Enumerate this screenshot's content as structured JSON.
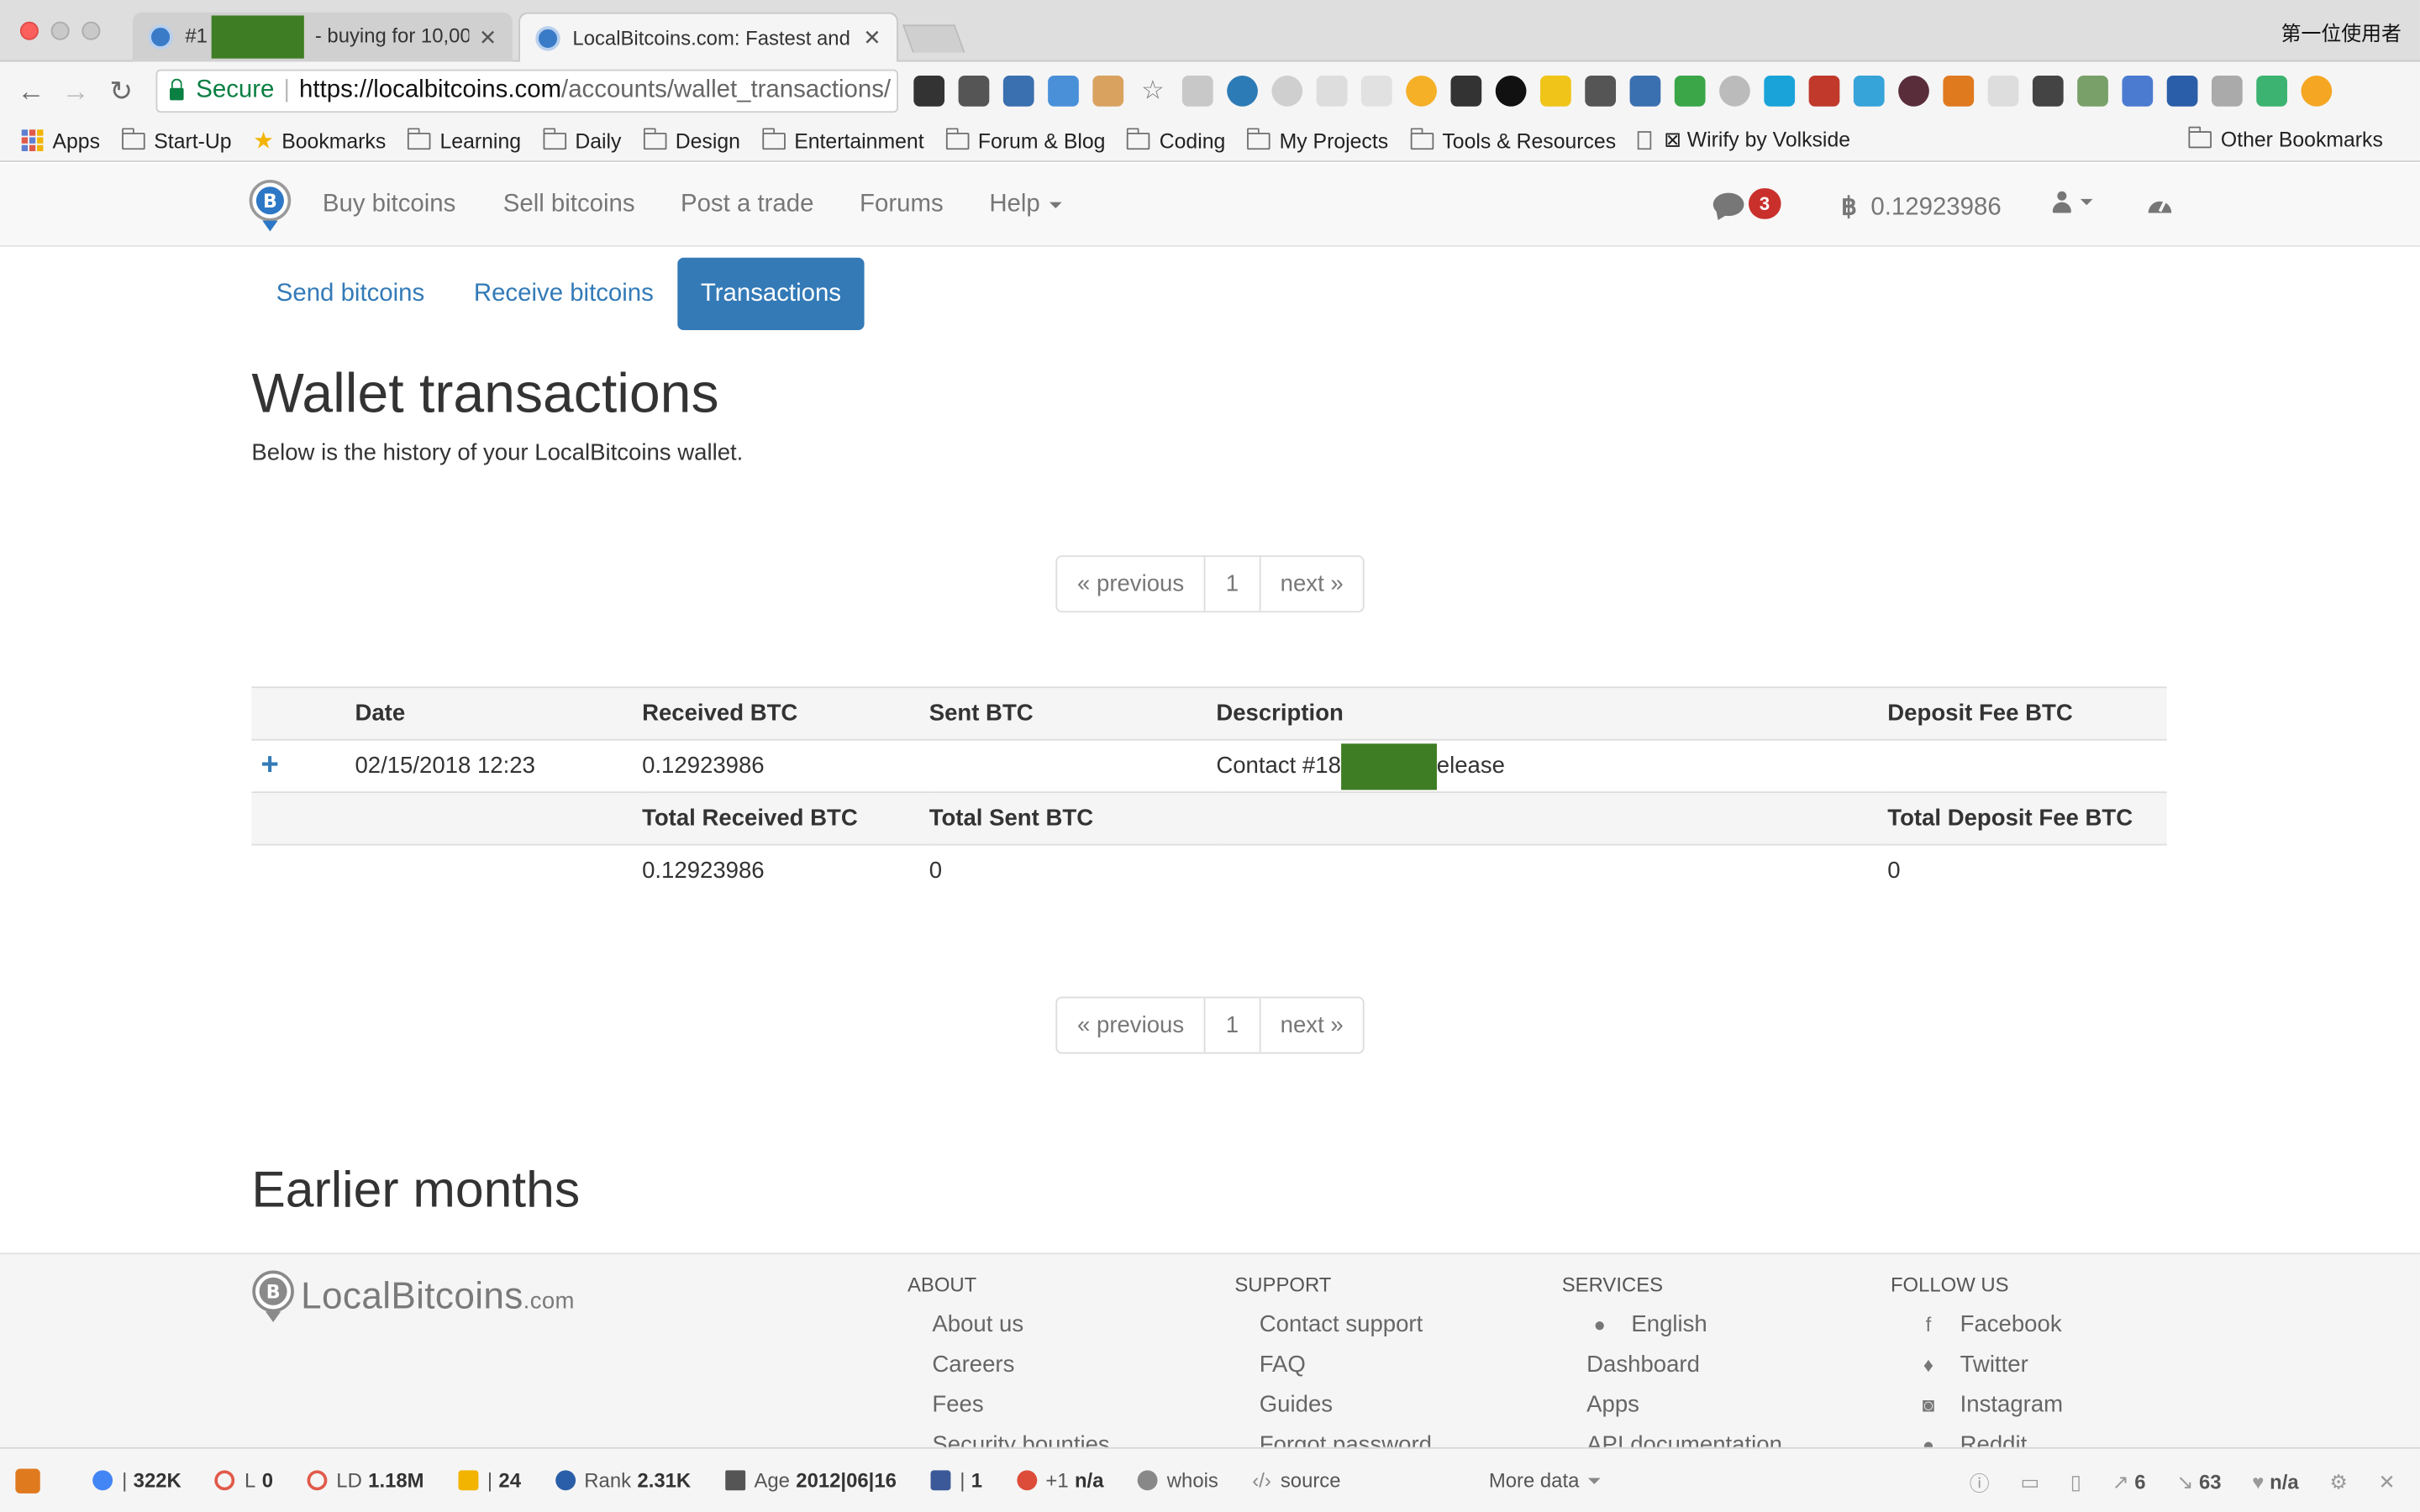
{
  "browser": {
    "tabs": [
      {
        "title_prefix": "#1",
        "title_suffix": " - buying for 10,00",
        "active": false
      },
      {
        "title": "LocalBitcoins.com: Fastest and",
        "active": true
      }
    ],
    "profile_name": "第一位使用者",
    "secure_label": "Secure",
    "url_host": "https://localbitcoins.com",
    "url_path": "/accounts/wallet_transactions/",
    "bookmarks": [
      "Apps",
      "Start-Up",
      "Bookmarks",
      "Learning",
      "Daily",
      "Design",
      "Entertainment",
      "Forum & Blog",
      "Coding",
      "My Projects",
      "Tools & Resources",
      "⊠ Wirify by Volkside"
    ],
    "other_bookmarks": "Other Bookmarks"
  },
  "nav": {
    "buy": "Buy bitcoins",
    "sell": "Sell bitcoins",
    "post": "Post a trade",
    "forums": "Forums",
    "help": "Help",
    "message_count": "3",
    "btc_symbol": "฿",
    "balance": "0.12923986"
  },
  "wallet_tabs": {
    "send": "Send bitcoins",
    "receive": "Receive bitcoins",
    "transactions": "Transactions"
  },
  "page": {
    "title": "Wallet transactions",
    "lead": "Below is the history of your LocalBitcoins wallet.",
    "earlier_title": "Earlier months"
  },
  "pagination": {
    "previous": "« previous",
    "page": "1",
    "next": "next »"
  },
  "table": {
    "headers": {
      "date": "Date",
      "received": "Received BTC",
      "sent": "Sent BTC",
      "description": "Description",
      "deposit_fee": "Deposit Fee BTC"
    },
    "rows": [
      {
        "expand": "+",
        "date": "02/15/2018 12:23",
        "received": "0.12923986",
        "sent": "",
        "description_prefix": "Contact #18",
        "description_suffix": "elease",
        "deposit_fee": ""
      }
    ],
    "totals_headers": {
      "received": "Total Received BTC",
      "sent": "Total Sent BTC",
      "deposit_fee": "Total Deposit Fee BTC"
    },
    "totals": {
      "received": "0.12923986",
      "sent": "0",
      "deposit_fee": "0"
    }
  },
  "footer": {
    "logo_text": "LocalBitcoins",
    "logo_suffix": ".com",
    "about": {
      "heading": "ABOUT",
      "items": [
        "About us",
        "Careers",
        "Fees",
        "Security bounties"
      ]
    },
    "support": {
      "heading": "SUPPORT",
      "items": [
        "Contact support",
        "FAQ",
        "Guides",
        "Forgot password"
      ]
    },
    "services": {
      "heading": "SERVICES",
      "items": [
        "English",
        "Dashboard",
        "Apps",
        "API documentation"
      ]
    },
    "follow": {
      "heading": "FOLLOW US",
      "items": [
        "Facebook",
        "Twitter",
        "Instagram",
        "Reddit"
      ]
    }
  },
  "seobar": {
    "google_index": "322K",
    "l_label": "L",
    "l_value": "0",
    "ld_label": "LD",
    "ld_value": "1.18M",
    "bing_index": "24",
    "rank_label": "Rank",
    "rank_value": "2.31K",
    "age_label": "Age",
    "age_value": "2012|06|16",
    "facebook_value": "1",
    "gplus_label": "+1",
    "gplus_value": "n/a",
    "whois": "whois",
    "source": "source",
    "more_data": "More data",
    "external_links": "6",
    "internal_links": "63",
    "density": "n/a"
  },
  "colors": {
    "link": "#337ab7",
    "active_pill": "#337ab7",
    "badge": "#c9302c",
    "secure": "#0b8043",
    "redaction": "#3f7d24"
  }
}
